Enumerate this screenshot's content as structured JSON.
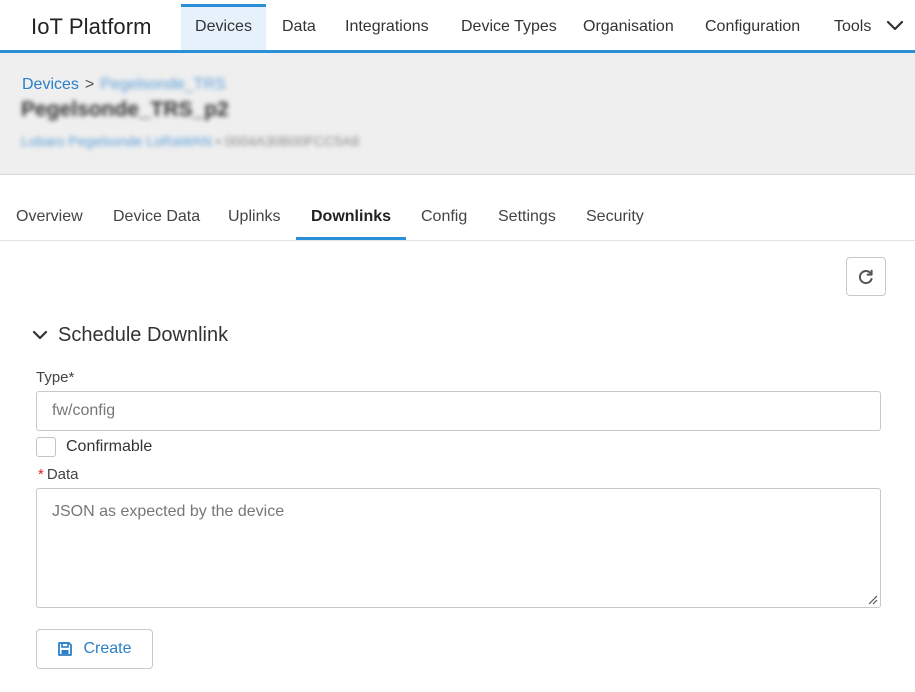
{
  "app": {
    "title": "IoT Platform"
  },
  "nav": {
    "items": [
      {
        "label": "Devices",
        "active": true
      },
      {
        "label": "Data"
      },
      {
        "label": "Integrations"
      },
      {
        "label": "Device Types"
      },
      {
        "label": "Organisation"
      },
      {
        "label": "Configuration"
      },
      {
        "label": "Tools"
      }
    ],
    "more_icon": "chevron-down-icon"
  },
  "breadcrumb": {
    "root": "Devices",
    "separator": ">",
    "current": "Pegelsonde_TRS"
  },
  "device": {
    "title": "Pegelsonde_TRS_p2",
    "subtitle_type": "Lobaro Pegelsonde LoRaWAN",
    "subtitle_sep": "•",
    "subtitle_id": "0004A30B00FCC5A8"
  },
  "tabs": [
    {
      "label": "Overview"
    },
    {
      "label": "Device Data"
    },
    {
      "label": "Uplinks"
    },
    {
      "label": "Downlinks",
      "active": true
    },
    {
      "label": "Config"
    },
    {
      "label": "Settings"
    },
    {
      "label": "Security"
    }
  ],
  "toolbar": {
    "refresh_icon": "refresh-icon"
  },
  "section": {
    "title": "Schedule Downlink",
    "expanded": true,
    "type_label": "Type*",
    "type_placeholder": "fw/config",
    "confirmable_label": "Confirmable",
    "confirmable_checked": false,
    "data_required_mark": "*",
    "data_label": "Data",
    "data_placeholder": "JSON as expected by the device",
    "create_label": "Create",
    "create_icon": "save-icon"
  },
  "colors": {
    "accent": "#2a8fd6",
    "link": "#2a7fc8",
    "header_bg": "#efefef",
    "required": "#dd2222"
  }
}
